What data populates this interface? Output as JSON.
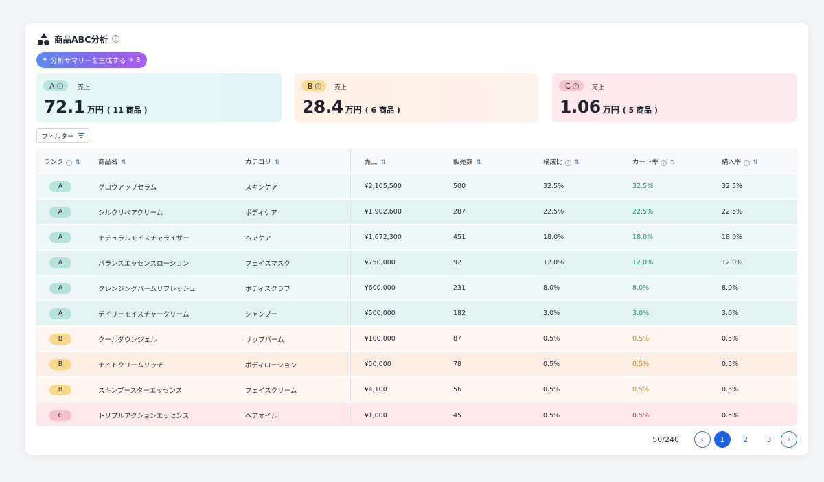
{
  "header": {
    "title": "商品ABC分析",
    "help": "?"
  },
  "generate_button": {
    "label": "分析サマリーを生成する",
    "credits": "8"
  },
  "summary": [
    {
      "rank": "A",
      "label": "売上",
      "value": "72.1",
      "unit": "万円",
      "count": "( 11 商品 )"
    },
    {
      "rank": "B",
      "label": "売上",
      "value": "28.4",
      "unit": "万円",
      "count": "( 6 商品 )"
    },
    {
      "rank": "C",
      "label": "売上",
      "value": "1.06",
      "unit": "万円",
      "count": "( 5 商品 )"
    }
  ],
  "filter": {
    "label": "フィルター"
  },
  "table": {
    "columns": [
      "ランク",
      "商品名",
      "カテゴリ",
      "売上",
      "販売数",
      "構成比",
      "カート率",
      "購入率"
    ],
    "rows": [
      {
        "rank": "A",
        "name": "グロウアップセラム",
        "category": "スキンケア",
        "sales": "¥2,105,500",
        "qty": "500",
        "share": "32.5%",
        "cart": "32.5%",
        "purchase": "32.5%"
      },
      {
        "rank": "A",
        "name": "シルクリペアクリーム",
        "category": "ボディケア",
        "sales": "¥1,902,600",
        "qty": "287",
        "share": "22.5%",
        "cart": "22.5%",
        "purchase": "22.5%"
      },
      {
        "rank": "A",
        "name": "ナチュラルモイスチャライザー",
        "category": "ヘアケア",
        "sales": "¥1,672,300",
        "qty": "451",
        "share": "18.0%",
        "cart": "18.0%",
        "purchase": "18.0%"
      },
      {
        "rank": "A",
        "name": "バランスエッセンスローション",
        "category": "フェイスマスク",
        "sales": "¥750,000",
        "qty": "92",
        "share": "12.0%",
        "cart": "12.0%",
        "purchase": "12.0%"
      },
      {
        "rank": "A",
        "name": "クレンジングバームリフレッシュ",
        "category": "ボディスクラブ",
        "sales": "¥600,000",
        "qty": "231",
        "share": "8.0%",
        "cart": "8.0%",
        "purchase": "8.0%"
      },
      {
        "rank": "A",
        "name": "デイリーモイスチャークリーム",
        "category": "シャンプー",
        "sales": "¥500,000",
        "qty": "182",
        "share": "3.0%",
        "cart": "3.0%",
        "purchase": "3.0%"
      },
      {
        "rank": "B",
        "name": "クールダウンジェル",
        "category": "リップバーム",
        "sales": "¥100,000",
        "qty": "87",
        "share": "0.5%",
        "cart": "0.5%",
        "purchase": "0.5%"
      },
      {
        "rank": "B",
        "name": "ナイトクリームリッチ",
        "category": "ボディローション",
        "sales": "¥50,000",
        "qty": "78",
        "share": "0.5%",
        "cart": "0.5%",
        "purchase": "0.5%"
      },
      {
        "rank": "B",
        "name": "スキンブースターエッセンス",
        "category": "フェイスクリーム",
        "sales": "¥4,100",
        "qty": "56",
        "share": "0.5%",
        "cart": "0.5%",
        "purchase": "0.5%"
      },
      {
        "rank": "C",
        "name": "トリプルアクションエッセンス",
        "category": "ヘアオイル",
        "sales": "¥1,000",
        "qty": "45",
        "share": "0.5%",
        "cart": "0.5%",
        "purchase": "0.5%"
      }
    ]
  },
  "pagination": {
    "count": "50/240",
    "pages": [
      "1",
      "2",
      "3"
    ],
    "current": "1"
  }
}
